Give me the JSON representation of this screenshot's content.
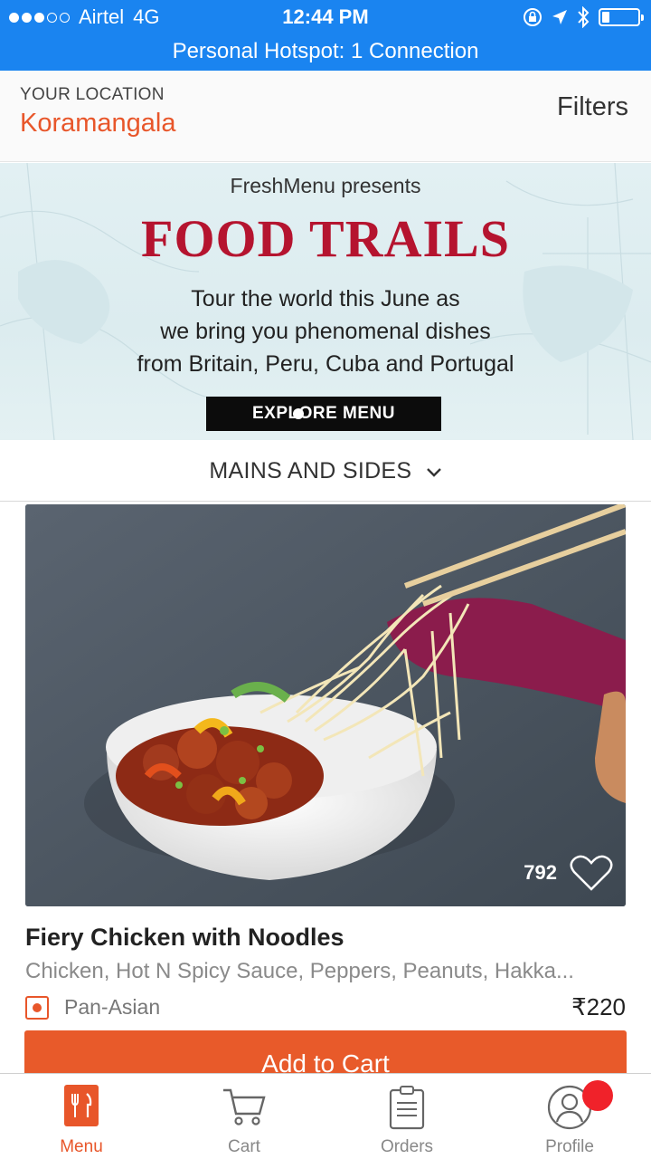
{
  "status_bar": {
    "carrier": "Airtel",
    "network": "4G",
    "time": "12:44 PM",
    "battery_level": 0.22,
    "signal_bars_filled": 3,
    "signal_bars_total": 5
  },
  "hotspot": {
    "text": "Personal Hotspot: 1 Connection"
  },
  "header": {
    "location_label": "YOUR LOCATION",
    "location_value": "Koramangala",
    "filters_label": "Filters"
  },
  "banner": {
    "presents": "FreshMenu presents",
    "title": "FOOD TRAILS",
    "tagline_1": "Tour the world this June as",
    "tagline_2": "we bring you phenomenal dishes",
    "tagline_3": "from Britain, Peru, Cuba and Portugal",
    "cta": "EXPLORE MENU"
  },
  "category": {
    "label": "MAINS AND SIDES",
    "icon": "chevron-down-icon"
  },
  "dish": {
    "likes": "792",
    "name": "Fiery Chicken with Noodles",
    "description": "Chicken, Hot N Spicy Sauce, Peppers, Peanuts, Hakka...",
    "cuisine": "Pan-Asian",
    "price": "₹220",
    "add_to_cart": "Add to Cart"
  },
  "bottom_nav": {
    "items": [
      {
        "label": "Menu",
        "icon": "menu-fork-knife-icon",
        "active": true
      },
      {
        "label": "Cart",
        "icon": "cart-icon",
        "active": false
      },
      {
        "label": "Orders",
        "icon": "clipboard-icon",
        "active": false
      },
      {
        "label": "Profile",
        "icon": "profile-icon",
        "active": false
      }
    ]
  },
  "colors": {
    "status_blue": "#1a84f0",
    "brand_orange": "#e8562a",
    "banner_red": "#b5142f",
    "notification_red": "#f0222a"
  }
}
